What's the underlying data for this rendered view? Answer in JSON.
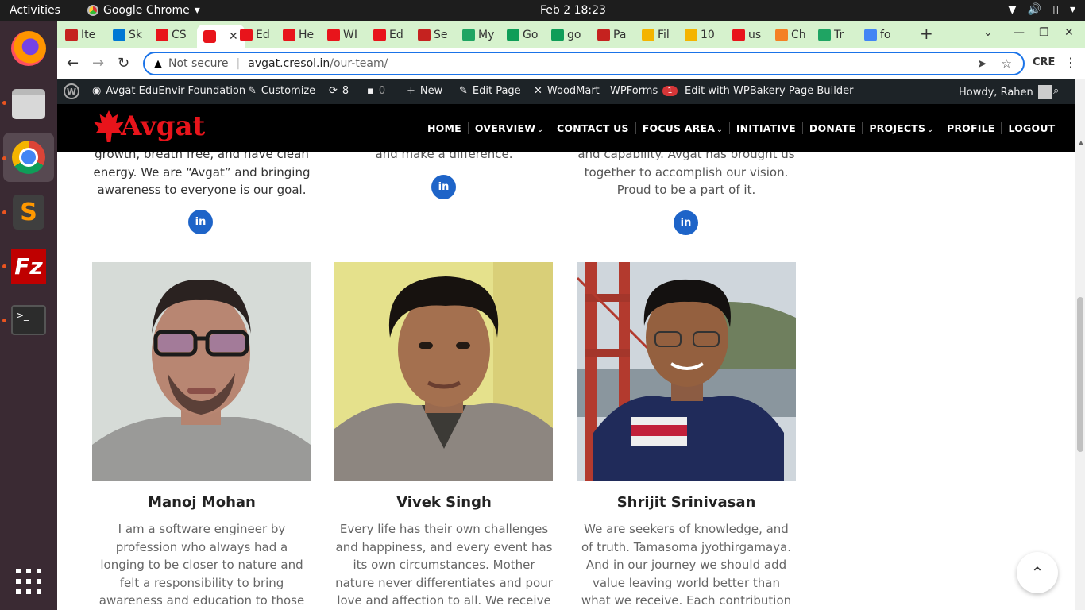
{
  "os": {
    "activities": "Activities",
    "app_name": "Google Chrome",
    "clock": "Feb 2  18:23"
  },
  "browser": {
    "tabs": [
      {
        "label": "Ite",
        "icon": "gmail-icon",
        "color": "#c5221f"
      },
      {
        "label": "Sk",
        "icon": "skype-icon",
        "color": "#0078d4"
      },
      {
        "label": "CS",
        "icon": "avgat-leaf-icon",
        "color": "#e8141b"
      },
      {
        "label": "",
        "icon": "avgat-leaf-icon",
        "color": "#e8141b"
      },
      {
        "label": "Ed",
        "icon": "avgat-leaf-icon",
        "color": "#e8141b"
      },
      {
        "label": "He",
        "icon": "avgat-leaf-icon",
        "color": "#e8141b"
      },
      {
        "label": "WI",
        "icon": "avgat-leaf-icon",
        "color": "#e8141b"
      },
      {
        "label": "Ed",
        "icon": "avgat-leaf-icon",
        "color": "#e8141b"
      },
      {
        "label": "Se",
        "icon": "gmail-icon",
        "color": "#c5221f"
      },
      {
        "label": "My",
        "icon": "google-drive-icon",
        "color": "#1fa463"
      },
      {
        "label": "Go",
        "icon": "google-sheets-icon",
        "color": "#0f9d58"
      },
      {
        "label": "go",
        "icon": "google-sheets-icon",
        "color": "#0f9d58"
      },
      {
        "label": "Pa",
        "icon": "gmail-icon",
        "color": "#c5221f"
      },
      {
        "label": "Fil",
        "icon": "folder-icon",
        "color": "#f4b400"
      },
      {
        "label": "10",
        "icon": "prize-icon",
        "color": "#f4b400"
      },
      {
        "label": "us",
        "icon": "avgat-leaf-icon",
        "color": "#e8141b"
      },
      {
        "label": "Ch",
        "icon": "stack-overflow-icon",
        "color": "#f48024"
      },
      {
        "label": "Tr",
        "icon": "w-icon",
        "color": "#1fa463"
      },
      {
        "label": "fo",
        "icon": "google-icon",
        "color": "#4285f4"
      }
    ],
    "active_tab_index": 3,
    "security_label": "Not secure",
    "url_host": "avgat.cresol.in",
    "url_path": "/our-team/",
    "extension_label": "CRE"
  },
  "adminbar": {
    "site_name": "Avgat EduEnvir Foundation",
    "customize": "Customize",
    "updates_count": "8",
    "comments_count": "0",
    "new": "New",
    "edit_page": "Edit Page",
    "woodmart": "WoodMart",
    "wpforms": "WPForms",
    "wpforms_badge": "1",
    "wpbakery": "Edit with WPBakery Page Builder",
    "howdy": "Howdy, Rahen"
  },
  "site": {
    "logo_text": "Avgat",
    "nav": [
      {
        "label": "HOME",
        "has_menu": false
      },
      {
        "label": "OVERVIEW",
        "has_menu": true
      },
      {
        "label": "CONTACT US",
        "has_menu": false
      },
      {
        "label": "FOCUS AREA",
        "has_menu": true
      },
      {
        "label": "INITIATIVE",
        "has_menu": false
      },
      {
        "label": "DONATE",
        "has_menu": false
      },
      {
        "label": "PROJECTS",
        "has_menu": true
      },
      {
        "label": "PROFILE",
        "has_menu": false
      },
      {
        "label": "LOGOUT",
        "has_menu": false
      }
    ]
  },
  "team_prev": {
    "col1_text": "growth, breath free, and have clean energy. We are “Avgat” and bringing awareness to everyone is our goal.",
    "col2_text": "and make a difference.",
    "col3_text": "and capability. Avgat has brought us together to accomplish our vision. Proud to be a part of it.",
    "linkedin_label": "in"
  },
  "team": [
    {
      "name": "Manoj Mohan",
      "bio": "I am a software engineer by profession who always had a longing to be closer to nature and felt a responsibility to bring awareness and education to those in need. I am part of Avgat"
    },
    {
      "name": "Vivek Singh",
      "bio": "Every life has their own challenges and happiness, and every event has its own circumstances. Mother nature never differentiates and pour love and affection to all. We receive a lot from"
    },
    {
      "name": "Shrijit Srinivasan",
      "bio": "We are seekers of knowledge, and of truth. Tamasoma jyothirgamaya. And in our journey we should add value leaving world better than what we receive. Each contribution is significant"
    }
  ]
}
